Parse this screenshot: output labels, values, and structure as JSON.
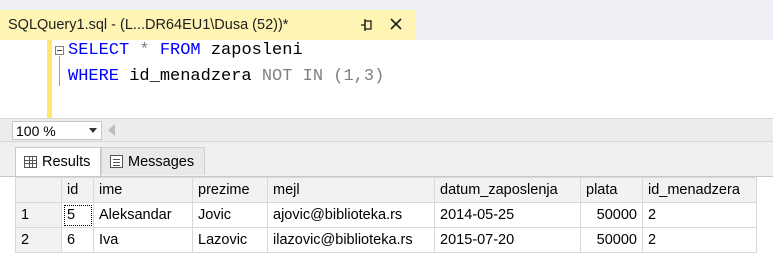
{
  "document_tab": {
    "title": "SQLQuery1.sql - (L...DR64EU1\\Dusa (52))*"
  },
  "editor": {
    "line1": {
      "kw1": "SELECT",
      "rest1": " * ",
      "kw2": "FROM",
      "rest2": " zaposleni"
    },
    "line2": {
      "kw1": "WHERE",
      "rest1": " id_menadzera ",
      "kw2": "NOT IN",
      "rest2": " (1,3)"
    }
  },
  "zoom": {
    "value": "100 %"
  },
  "result_tabs": [
    {
      "label": "Results",
      "icon": "grid-icon"
    },
    {
      "label": "Messages",
      "icon": "messages-icon"
    }
  ],
  "results": {
    "columns": [
      "id",
      "ime",
      "prezime",
      "mejl",
      "datum_zaposlenja",
      "plata",
      "id_menadzera"
    ],
    "rows": [
      {
        "rownum": "1",
        "cells": [
          "5",
          "Aleksandar",
          "Jovic",
          "ajovic@biblioteka.rs",
          "2014-05-25",
          "50000",
          "2"
        ]
      },
      {
        "rownum": "2",
        "cells": [
          "6",
          "Iva",
          "Lazovic",
          "ilazovic@biblioteka.rs",
          "2015-07-20",
          "50000",
          "2"
        ]
      }
    ]
  },
  "colors": {
    "tab_active": "#fef5b5",
    "keyword": "#0000ff",
    "selection_margin": "#ffe86b"
  }
}
